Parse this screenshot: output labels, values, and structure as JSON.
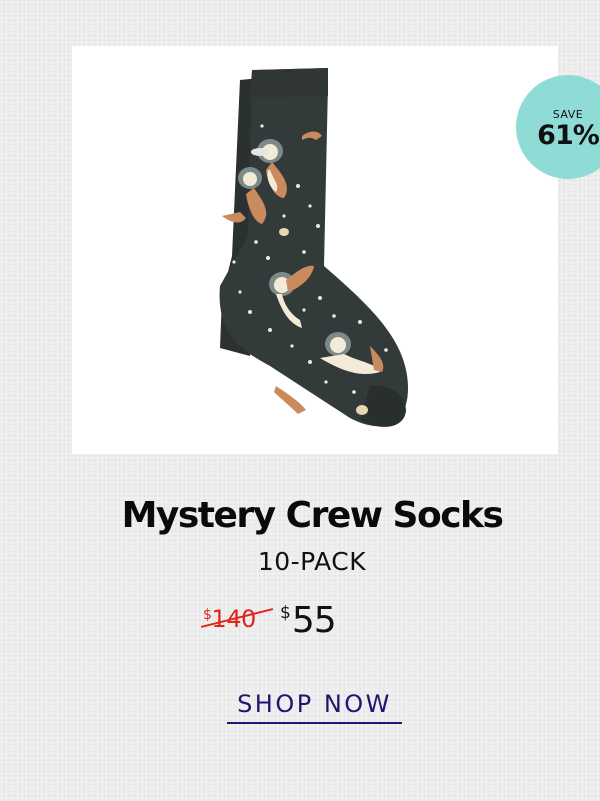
{
  "product": {
    "image_alt": "space otter crew socks",
    "badge": {
      "label": "SAVE",
      "value": "61%"
    },
    "title": "Mystery Crew Socks",
    "subtitle": "10-PACK",
    "old_price": {
      "currency": "$",
      "amount": "140"
    },
    "new_price": {
      "currency": "$",
      "amount": "55"
    },
    "cta_label": "SHOP NOW"
  },
  "colors": {
    "badge_bg": "#8fdcd6",
    "old_price": "#e0261c",
    "cta": "#1e1670",
    "sock": "#333b3a"
  }
}
